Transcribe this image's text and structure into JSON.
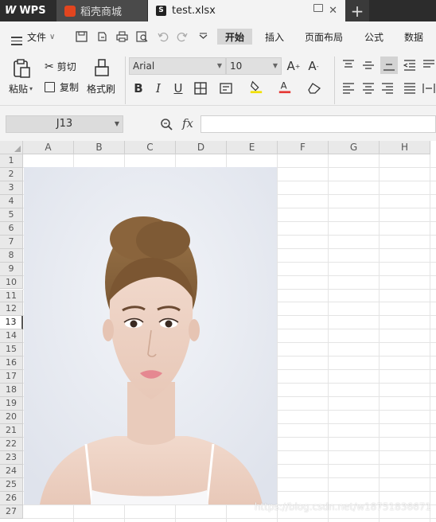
{
  "titlebar": {
    "app_name": "WPS",
    "tabs": [
      {
        "label": "稻壳商城"
      },
      {
        "label": "test.xlsx"
      }
    ],
    "add_tab": "+"
  },
  "menu": {
    "file_label": "文件",
    "items": [
      "开始",
      "插入",
      "页面布局",
      "公式",
      "数据"
    ],
    "active": "开始"
  },
  "ribbon": {
    "paste": "粘贴",
    "cut": "剪切",
    "copy": "复制",
    "format_painter": "格式刷",
    "font_name": "Arial",
    "font_size": "10",
    "bold": "B",
    "italic": "I",
    "underline": "U"
  },
  "formula_bar": {
    "name_box": "J13",
    "fx": "fx",
    "formula": ""
  },
  "sheet": {
    "columns": [
      "A",
      "B",
      "C",
      "D",
      "E",
      "F",
      "G",
      "H"
    ],
    "rows": [
      "1",
      "2",
      "3",
      "4",
      "5",
      "6",
      "7",
      "8",
      "9",
      "10",
      "11",
      "12",
      "13",
      "14",
      "15",
      "16",
      "17",
      "18",
      "19",
      "20",
      "21",
      "22",
      "23",
      "24",
      "25",
      "26",
      "27"
    ],
    "active_row": "13"
  },
  "watermark": "https://blog.csdn.net/w18751836671",
  "colors": {
    "titlebar_bg": "#2c2c2c",
    "ribbon_bg": "#f3f3f3",
    "accent_tab": "#e2451f",
    "font_color_accent": "#e53935",
    "highlight_accent": "#f2e000"
  }
}
